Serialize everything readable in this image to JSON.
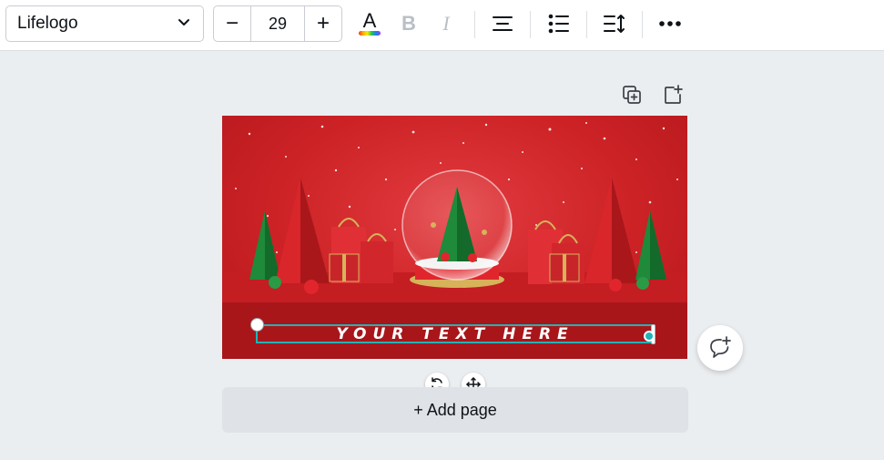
{
  "toolbar": {
    "font_name": "Lifelogo",
    "font_size": "29",
    "decrease_label": "−",
    "increase_label": "+",
    "text_color_glyph": "A",
    "bold_glyph": "B",
    "italic_glyph": "I",
    "icons": [
      "chevron-down-icon",
      "text-color-icon",
      "bold-icon",
      "italic-icon",
      "align-center-icon",
      "list-icon",
      "spacing-icon",
      "more-icon"
    ]
  },
  "page_tools": {
    "icons": [
      "duplicate-page-icon",
      "add-page-icon"
    ]
  },
  "canvas": {
    "text": "YOUR TEXT HERE",
    "accent_color": "#22b3b6",
    "background_color": "#cc2226"
  },
  "element_tools": {
    "icons": [
      "rotate-icon",
      "move-icon"
    ]
  },
  "add_page": {
    "label": "+ Add page"
  },
  "comment": {
    "icon": "add-comment-icon"
  }
}
